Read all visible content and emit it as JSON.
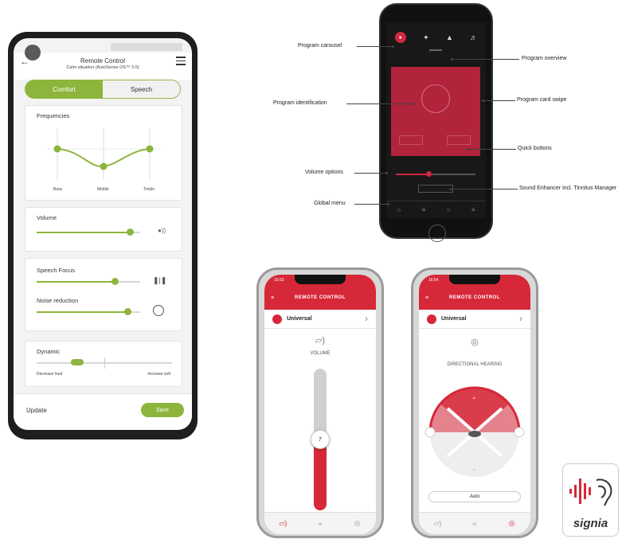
{
  "phone_a": {
    "header": {
      "title": "Remote Control",
      "subtitle": "Calm situation (AutoSense OS™ 3.0)"
    },
    "tabs": {
      "comfort": "Comfort",
      "speech": "Speech"
    },
    "frequencies": {
      "title": "Frequencies",
      "bass": "Bass",
      "middle": "Middle",
      "treble": "Treble"
    },
    "volume": {
      "title": "Volume",
      "level": 0.9
    },
    "speech_focus": {
      "title": "Speech Focus",
      "level": 0.75
    },
    "noise_reduction": {
      "title": "Noise reduction",
      "level": 0.88
    },
    "dynamic": {
      "title": "Dynamic",
      "left": "Decrease loud",
      "right": "Increase soft",
      "level": 0.3
    },
    "footer": {
      "update": "Update",
      "save": "Save"
    },
    "accent": "#8db53c"
  },
  "phone_b": {
    "annotations": {
      "program_carousel": "Program carousel",
      "program_overview": "Program overview",
      "program_identification": "Program identification",
      "program_card_swipe": "Program card swipe",
      "quick_buttons": "Quick buttons",
      "volume_options": "Volume options",
      "sound_enhancer": "Sound Enhancer incl. Tinnitus Manager",
      "global_menu": "Global menu"
    },
    "accent": "#b2233c"
  },
  "phone_c": {
    "time": "16:53",
    "title": "REMOTE CONTROL",
    "program": "Universal",
    "section": "VOLUME",
    "volume_value": "7",
    "volume_level": 0.5
  },
  "phone_d": {
    "time": "16:54",
    "title": "REMOTE CONTROL",
    "program": "Universal",
    "section": "DIRECTIONAL HEARING",
    "auto": "Auto"
  },
  "logo": {
    "text": "signia"
  },
  "red": "#d62839"
}
